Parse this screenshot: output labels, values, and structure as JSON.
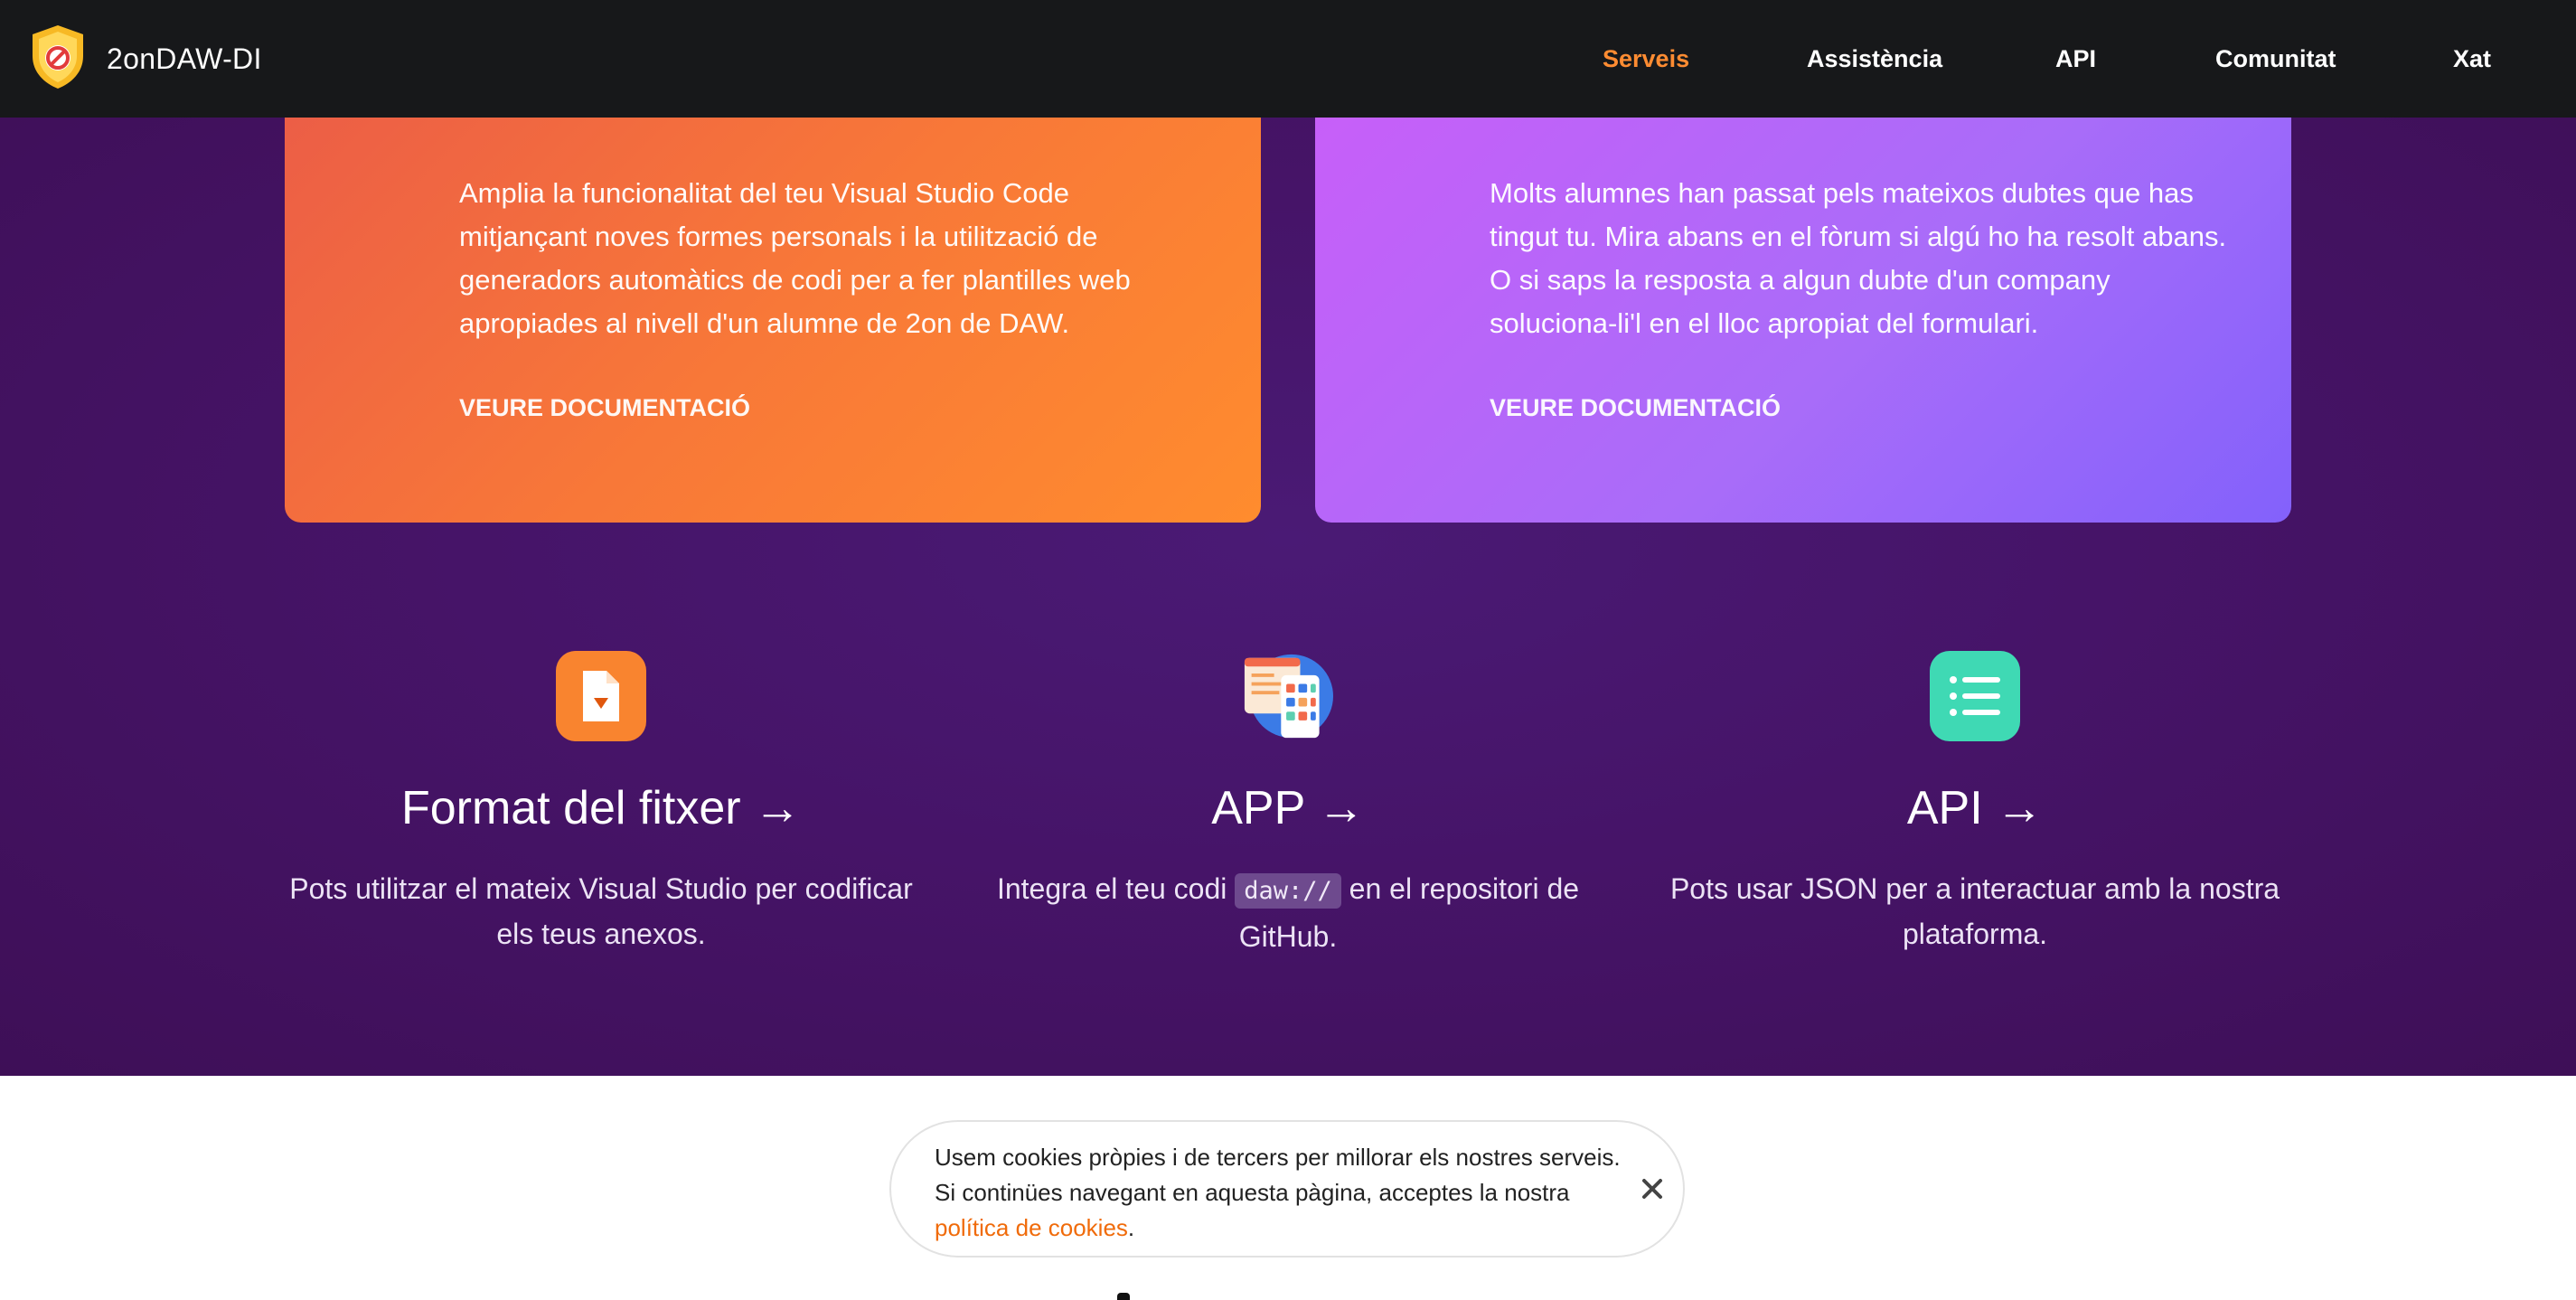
{
  "nav": {
    "brand": "2onDAW-DI",
    "items": [
      {
        "label": "Serveis",
        "active": true
      },
      {
        "label": "Assistència",
        "active": false
      },
      {
        "label": "API",
        "active": false
      },
      {
        "label": "Comunitat",
        "active": false
      },
      {
        "label": "Xat",
        "active": false
      }
    ]
  },
  "cards": [
    {
      "text": "Amplia la funcionalitat del teu Visual Studio Code mitjançant noves formes personals i la utilització de generadors automàtics de codi per a fer plantilles web apropiades al nivell d'un alumne de 2on de DAW.",
      "link": "VEURE DOCUMENTACIÓ"
    },
    {
      "text": "Molts alumnes han passat pels mateixos dubtes que has tingut tu. Mira abans en el fòrum si algú ho ha resolt abans. O si saps la resposta a algun dubte d'un company soluciona-li'l en el lloc apropiat del formulari.",
      "link": "VEURE DOCUMENTACIÓ"
    }
  ],
  "features": [
    {
      "icon": "file-icon",
      "title": "Format del fitxer →",
      "desc": "Pots utilitzar el mateix Visual Studio per codificar els teus anexos."
    },
    {
      "icon": "app-icon",
      "title": "APP →",
      "desc_before": "Integra el teu codi",
      "code": "daw://",
      "desc_after": "en el repositori de GitHub."
    },
    {
      "icon": "list-icon",
      "title": "API →",
      "desc": "Pots usar JSON per a interactuar amb la nostra plataforma."
    }
  ],
  "cookie": {
    "text": "Usem cookies pròpies i de tercers per millorar els nostres serveis. Si continües navegant en aquesta pàgina, acceptes la nostra",
    "link": "política de cookies",
    "end": ".",
    "close_icon": "close-icon"
  },
  "colors": {
    "navbar": "#17181a",
    "accent": "#ff8c32",
    "section_bg": "#461468",
    "card_orange": "#f87838",
    "card_violet": "#a96cf9",
    "icon_orange": "#f9842f",
    "icon_teal": "#3fd9b4"
  }
}
